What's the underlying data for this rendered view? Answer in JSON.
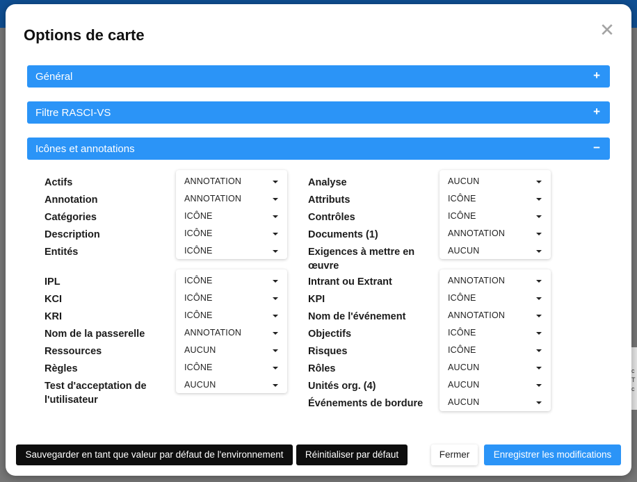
{
  "background": {
    "edge_text": "c T c"
  },
  "modal": {
    "title": "Options de carte",
    "close_glyph": "✕"
  },
  "colors": {
    "accent": "#2b94f7",
    "dark_button": "#0e0e0e",
    "topbar": "#0f4f93"
  },
  "sections": [
    {
      "label": "Général",
      "sign": "+",
      "expanded": false
    },
    {
      "label": "Filtre RASCI-VS",
      "sign": "+",
      "expanded": false
    },
    {
      "label": "Icônes et annotations",
      "sign": "−",
      "expanded": true
    }
  ],
  "left_group1": [
    {
      "label": "Actifs",
      "value": "ANNOTATION"
    },
    {
      "label": "Annotation",
      "value": "ANNOTATION"
    },
    {
      "label": "Catégories",
      "value": "ICÔNE"
    },
    {
      "label": "Description",
      "value": "ICÔNE"
    },
    {
      "label": "Entités",
      "value": "ICÔNE"
    }
  ],
  "left_group2": [
    {
      "label": "IPL",
      "value": "ICÔNE"
    },
    {
      "label": "KCI",
      "value": "ICÔNE"
    },
    {
      "label": "KRI",
      "value": "ICÔNE"
    },
    {
      "label": "Nom de la passerelle",
      "value": "ANNOTATION"
    },
    {
      "label": "Ressources",
      "value": "AUCUN"
    },
    {
      "label": "Règles",
      "value": "ICÔNE"
    },
    {
      "label": "Test d'acceptation de",
      "label2": "l'utilisateur",
      "value": "AUCUN"
    }
  ],
  "right_group1": [
    {
      "label": "Analyse",
      "value": "AUCUN"
    },
    {
      "label": "Attributs",
      "value": "ICÔNE"
    },
    {
      "label": "Contrôles",
      "value": "ICÔNE"
    },
    {
      "label": "Documents (1)",
      "value": "ANNOTATION"
    },
    {
      "label": "Exigences à mettre en",
      "label2": "œuvre",
      "value": "AUCUN"
    }
  ],
  "right_group2": [
    {
      "label": "Intrant ou Extrant",
      "value": "ANNOTATION"
    },
    {
      "label": "KPI",
      "value": "ICÔNE"
    },
    {
      "label": "Nom de l'événement",
      "value": "ANNOTATION"
    },
    {
      "label": "Objectifs",
      "value": "ICÔNE"
    },
    {
      "label": "Risques",
      "value": "ICÔNE"
    },
    {
      "label": "Rôles",
      "value": "AUCUN"
    },
    {
      "label": "Unités org. (4)",
      "value": "AUCUN"
    },
    {
      "label": "Événements de bordure",
      "value": "AUCUN"
    }
  ],
  "footer": {
    "save_default": "Sauvegarder en tant que valeur par défaut de l'environnement",
    "reset_default": "Réinitialiser par défaut",
    "close": "Fermer",
    "save_changes": "Enregistrer les modifications"
  }
}
